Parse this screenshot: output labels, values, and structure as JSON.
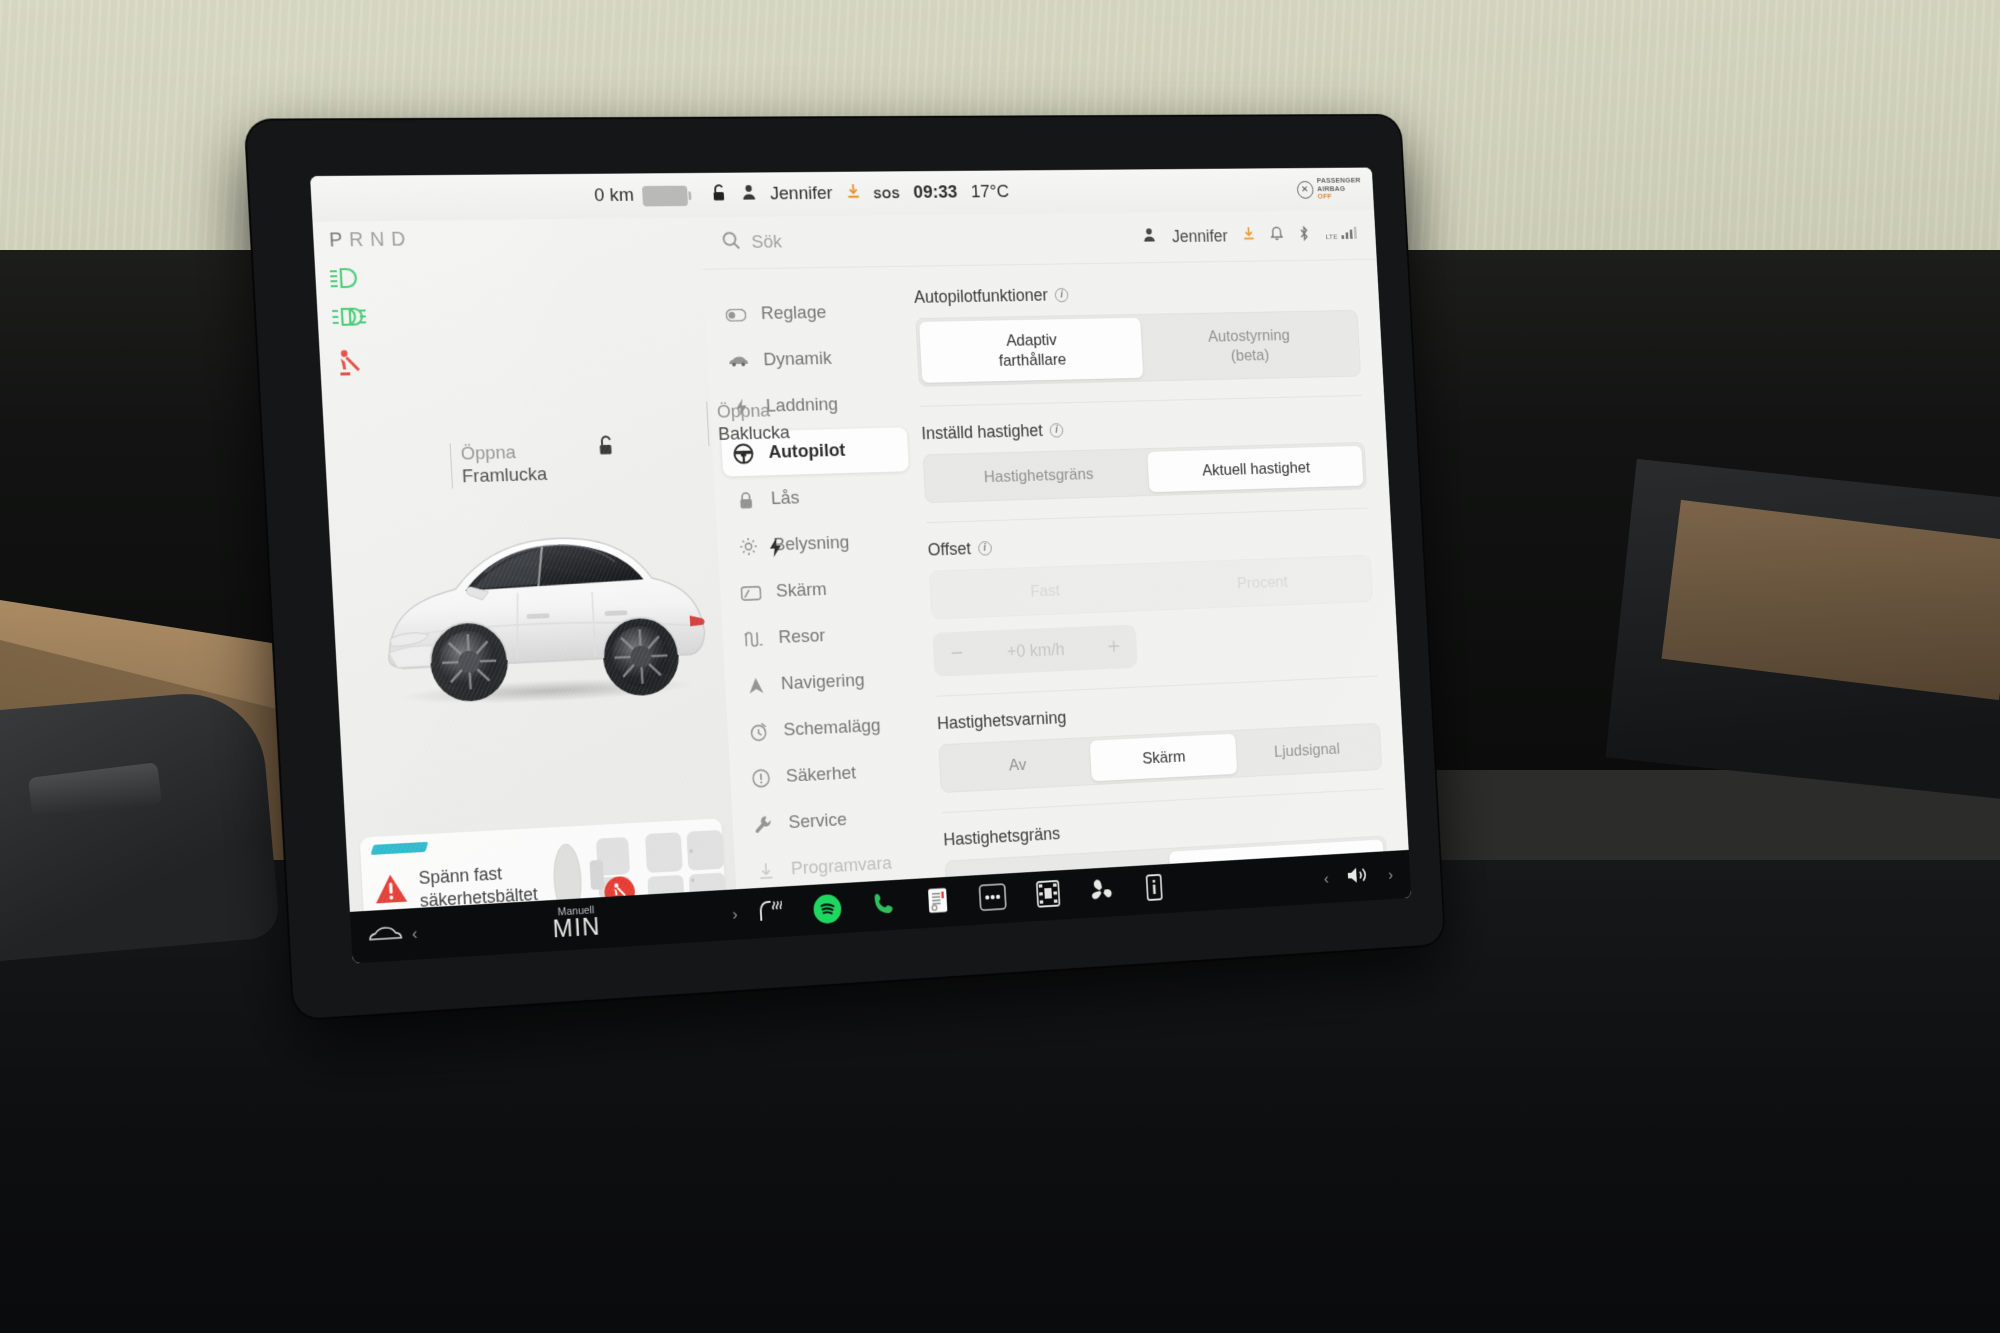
{
  "status_bar": {
    "range": "0 km",
    "driver_profile": "Jennifer",
    "sos_label": "SOS",
    "time": "09:33",
    "temperature": "17°C",
    "airbag_line1": "PASSENGER",
    "airbag_line2": "AIRBAG",
    "airbag_state": "OFF",
    "icons": {
      "battery": "battery-icon",
      "unlock": "unlock-icon",
      "person": "person-icon",
      "download": "download-icon"
    }
  },
  "car_view": {
    "gear_indicator": "PRND",
    "gear_selected": "P",
    "tell_tales": [
      {
        "name": "low-beam-icon",
        "color": "#2fbf5c"
      },
      {
        "name": "fog-light-icon",
        "color": "#2fbf5c"
      },
      {
        "name": "seatbelt-warning-icon",
        "color": "#e0342b"
      }
    ],
    "open_frunk": {
      "line1": "Öppna",
      "line2": "Framlucka"
    },
    "open_trunk": {
      "line1": "Öppna",
      "line2": "Baklucka"
    },
    "warning_card": {
      "line1": "Spänn fast",
      "line2": "säkerhetsbältet",
      "icon": "warning-triangle-icon",
      "accent": "#e0342b"
    }
  },
  "settings": {
    "search": {
      "placeholder": "Sök",
      "icon": "search-icon"
    },
    "search_right": {
      "profile_name": "Jennifer",
      "icons": [
        "download-icon",
        "bell-icon",
        "bluetooth-icon",
        "signal-icon"
      ],
      "network": "LTE"
    },
    "nav": [
      {
        "label": "Reglage",
        "icon": "toggle-icon",
        "active": false
      },
      {
        "label": "Dynamik",
        "icon": "car-icon",
        "active": false
      },
      {
        "label": "Laddning",
        "icon": "bolt-icon",
        "active": false
      },
      {
        "label": "Autopilot",
        "icon": "steering-icon",
        "active": true
      },
      {
        "label": "Lås",
        "icon": "lock-icon",
        "active": false
      },
      {
        "label": "Belysning",
        "icon": "sun-icon",
        "active": false
      },
      {
        "label": "Skärm",
        "icon": "display-icon",
        "active": false
      },
      {
        "label": "Resor",
        "icon": "trips-icon",
        "active": false
      },
      {
        "label": "Navigering",
        "icon": "navigation-icon",
        "active": false
      },
      {
        "label": "Schemalägg",
        "icon": "schedule-icon",
        "active": false
      },
      {
        "label": "Säkerhet",
        "icon": "safety-icon",
        "active": false
      },
      {
        "label": "Service",
        "icon": "wrench-icon",
        "active": false
      },
      {
        "label": "Programvara",
        "icon": "software-icon",
        "active": false
      }
    ],
    "panel": {
      "autopilot_features": {
        "title": "Autopilotfunktioner",
        "options": [
          {
            "label": "Adaptiv\nfarthållare",
            "line1": "Adaptiv",
            "line2": "farthållare",
            "selected": true
          },
          {
            "label": "Autostyrning\n(beta)",
            "line1": "Autostyrning",
            "line2": "(beta)",
            "selected": false
          }
        ]
      },
      "set_speed": {
        "title": "Inställd hastighet",
        "options": [
          {
            "label": "Hastighetsgräns",
            "selected": false
          },
          {
            "label": "Aktuell hastighet",
            "selected": true
          }
        ]
      },
      "offset": {
        "title": "Offset",
        "disabled": true,
        "options": [
          {
            "label": "Fast",
            "selected": false
          },
          {
            "label": "Procent",
            "selected": false
          }
        ],
        "stepper": {
          "minus": "−",
          "value": "+0 km/h",
          "plus": "+"
        }
      },
      "speed_warning": {
        "title": "Hastighetsvarning",
        "options": [
          {
            "label": "Av",
            "selected": false
          },
          {
            "label": "Skärm",
            "selected": true
          },
          {
            "label": "Ljudsignal",
            "selected": false
          }
        ]
      },
      "speed_limit": {
        "title": "Hastighetsgräns"
      }
    }
  },
  "dock": {
    "car_icon": "car-icon",
    "climate": {
      "mode": "Manuell",
      "temp": "MIN",
      "chevron_left": "‹",
      "chevron_right": "›"
    },
    "apps": [
      {
        "name": "seat-heater-icon"
      },
      {
        "name": "spotify-icon",
        "color": "#1ed760"
      },
      {
        "name": "phone-icon",
        "color": "#2fbf5c"
      },
      {
        "name": "calendar-icon"
      },
      {
        "name": "more-icon"
      },
      {
        "name": "media-icon"
      },
      {
        "name": "fan-icon"
      },
      {
        "name": "info-icon"
      }
    ],
    "volume": {
      "icon": "volume-icon",
      "left": "‹",
      "right": "›"
    }
  }
}
